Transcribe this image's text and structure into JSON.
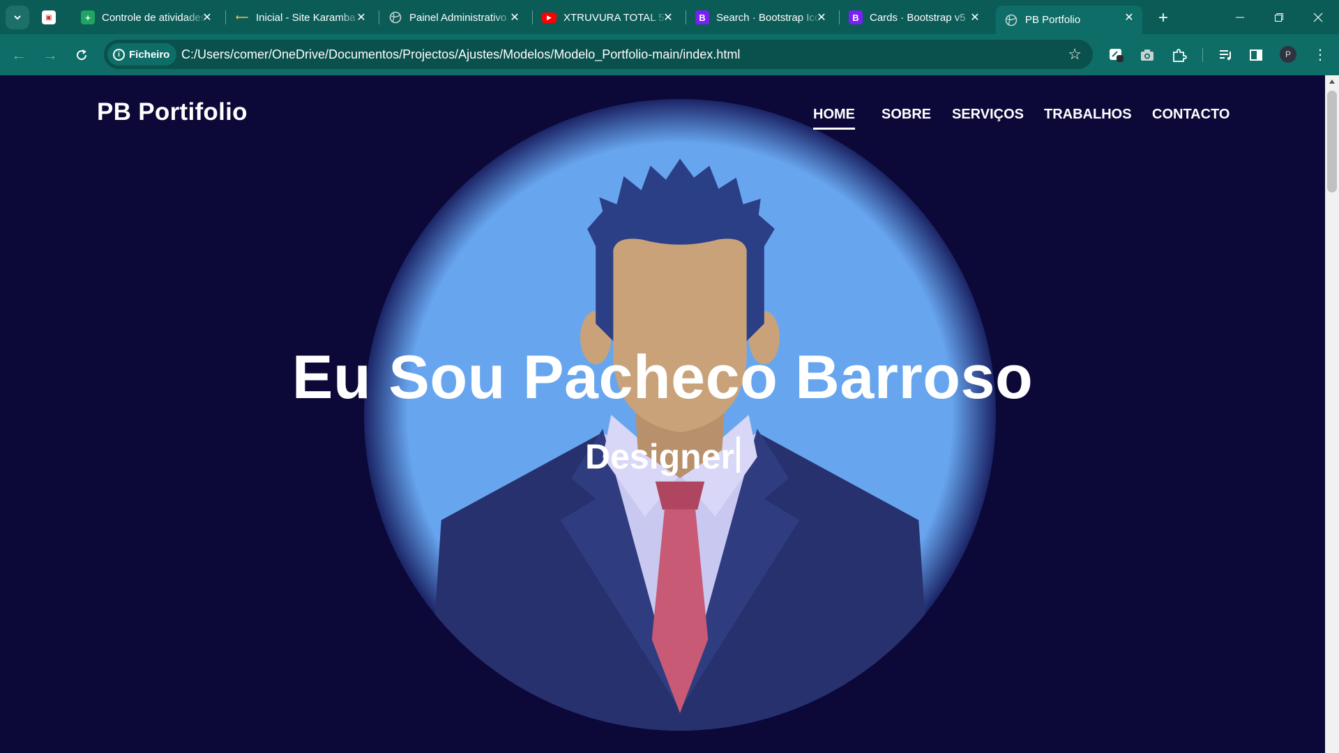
{
  "browser": {
    "tabs": [
      {
        "title": "",
        "favicon": "document-favicon",
        "color": "#ffffff"
      },
      {
        "title": "Controle de atividades",
        "favicon": "sheets-favicon",
        "color": "#1fa463"
      },
      {
        "title": "Inicial - Site Karamba",
        "favicon": "karamba-favicon",
        "color": "#e8b64c"
      },
      {
        "title": "Painel Administrativo",
        "favicon": "globe-favicon",
        "color": "#c9d3d2"
      },
      {
        "title": "XTRUVURA TOTAL 5",
        "favicon": "youtube-favicon",
        "color": "#ff0000"
      },
      {
        "title": "Search · Bootstrap Icons",
        "favicon": "bootstrap-favicon",
        "color": "#7a1ff5"
      },
      {
        "title": "Cards · Bootstrap v5",
        "favicon": "bootstrap-favicon",
        "color": "#7a1ff5"
      },
      {
        "title": "PB Portfolio",
        "favicon": "globe-favicon",
        "color": "#c9d3d2"
      }
    ],
    "site_info_label": "Ficheiro",
    "url": "C:/Users/comer/OneDrive/Documentos/Projectos/Ajustes/Modelos/Modelo_Portfolio-main/index.html",
    "profile_initial": "P"
  },
  "page": {
    "brand": "PB Portifolio",
    "nav": [
      {
        "label": "HOME",
        "active": true
      },
      {
        "label": "SOBRE",
        "active": false
      },
      {
        "label": "SERVIÇOS",
        "active": false
      },
      {
        "label": "TRABALHOS",
        "active": false
      },
      {
        "label": "CONTACTO",
        "active": false
      }
    ],
    "hero_title": "Eu Sou Pacheco Barroso",
    "hero_subtitle": "Designer"
  },
  "colors": {
    "background": "#0c0838",
    "hero_circle": "#67a6ef",
    "suit": "#27316e",
    "tie": "#c85a75",
    "skin": "#c9a27a",
    "hair": "#2a3f85",
    "chrome": "#0b5c57"
  }
}
